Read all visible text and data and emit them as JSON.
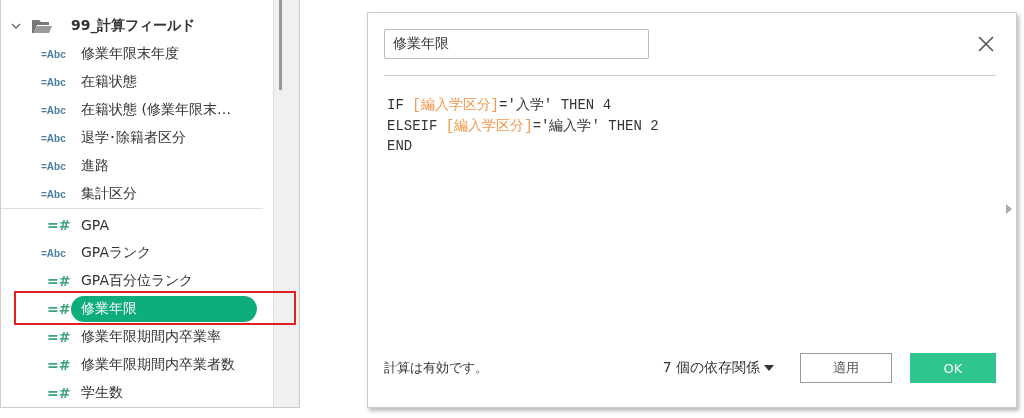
{
  "folder": {
    "name": "99_計算フィールド",
    "expanded": true,
    "groups": [
      {
        "items": [
          {
            "kind": "string",
            "badge": "=Abc",
            "label": "修業年限末年度",
            "selected": false
          },
          {
            "kind": "string",
            "badge": "=Abc",
            "label": "在籍状態",
            "selected": false
          },
          {
            "kind": "string",
            "badge": "=Abc",
            "label": "在籍状態 (修業年限末…",
            "selected": false
          },
          {
            "kind": "string",
            "badge": "=Abc",
            "label": "退学･除籍者区分",
            "selected": false
          },
          {
            "kind": "string",
            "badge": "=Abc",
            "label": "進路",
            "selected": false
          },
          {
            "kind": "string",
            "badge": "=Abc",
            "label": "集計区分",
            "selected": false
          }
        ]
      },
      {
        "items": [
          {
            "kind": "number",
            "badge": "=#",
            "label": "GPA",
            "selected": false
          },
          {
            "kind": "string",
            "badge": "=Abc",
            "label": "GPAランク",
            "selected": false
          },
          {
            "kind": "number",
            "badge": "=#",
            "label": "GPA百分位ランク",
            "selected": false
          },
          {
            "kind": "number",
            "badge": "=#",
            "label": "修業年限",
            "selected": true
          },
          {
            "kind": "number",
            "badge": "=#",
            "label": "修業年限期間内卒業率",
            "selected": false
          },
          {
            "kind": "number",
            "badge": "=#",
            "label": "修業年限期間内卒業者数",
            "selected": false
          },
          {
            "kind": "number",
            "badge": "=#",
            "label": "学生数",
            "selected": false
          }
        ]
      }
    ]
  },
  "dialog": {
    "name_field": "修業年限",
    "code": [
      [
        {
          "kind": "text",
          "text": "IF "
        },
        {
          "kind": "field",
          "text": "[編入学区分]"
        },
        {
          "kind": "text",
          "text": "='入学' THEN 4"
        }
      ],
      [
        {
          "kind": "text",
          "text": "ELSEIF "
        },
        {
          "kind": "field",
          "text": "[編入学区分]"
        },
        {
          "kind": "text",
          "text": "='編入学' THEN 2"
        }
      ],
      [
        {
          "kind": "text",
          "text": "END"
        }
      ]
    ],
    "status": "計算は有効です。",
    "dependencies": "7 個の依存関係",
    "buttons": [
      {
        "kind": "secondary",
        "label": "適用"
      },
      {
        "kind": "primary",
        "label": "OK"
      }
    ]
  }
}
